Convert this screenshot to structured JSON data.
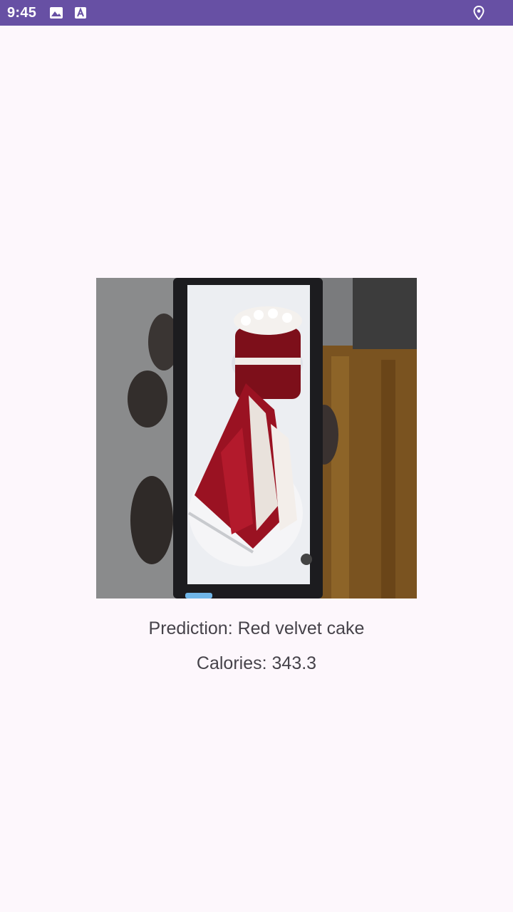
{
  "status_bar": {
    "time": "9:45",
    "icons": [
      "image-icon",
      "text-a-icon",
      "location-pin-icon"
    ],
    "background": "#6750a4"
  },
  "main": {
    "photo_description_icon": "food-photo",
    "prediction_text": "Prediction: Red velvet cake",
    "calories_text": "Calories: 343.3"
  },
  "colors": {
    "background": "#fdf7fc",
    "text": "#46434a"
  }
}
